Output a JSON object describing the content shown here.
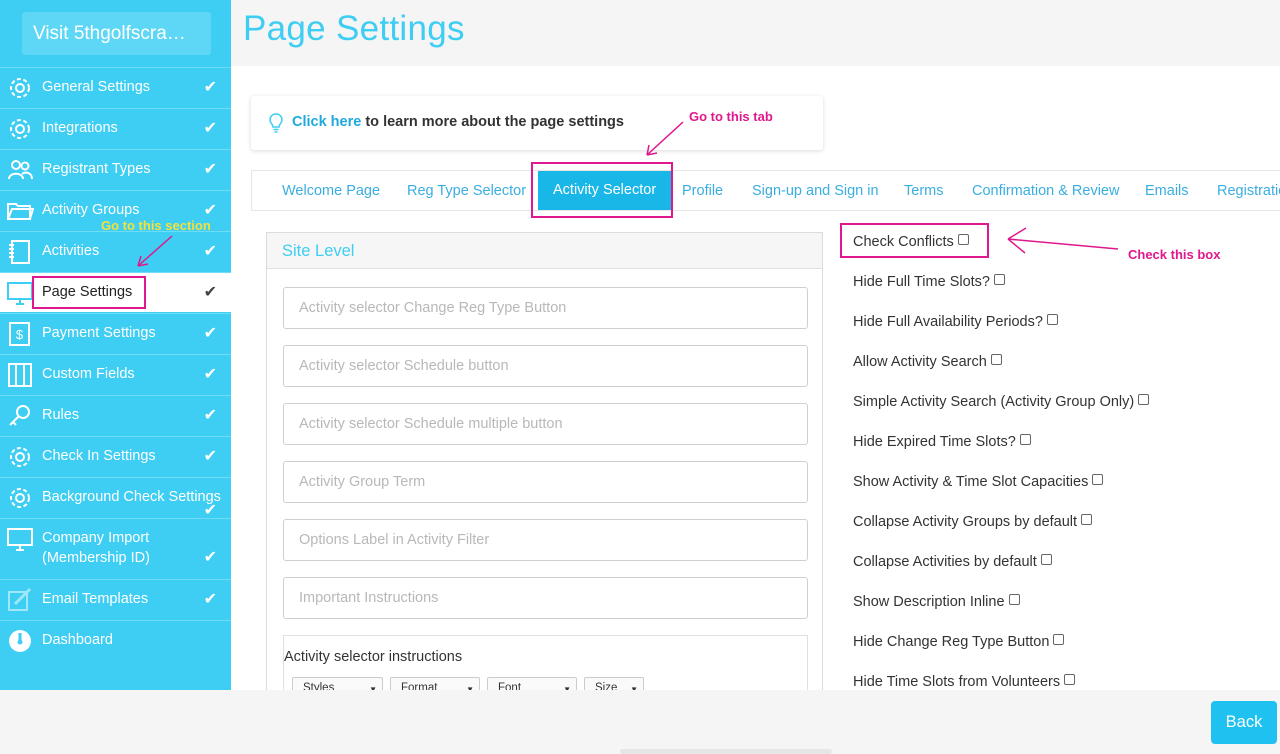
{
  "sidebar": {
    "visit_button": "Visit 5thgolfscra…",
    "items": [
      {
        "label": "General Settings",
        "icon": "gear-icon",
        "check": "✔"
      },
      {
        "label": "Integrations",
        "icon": "gear-icon",
        "check": "✔"
      },
      {
        "label": "Registrant Types",
        "icon": "users-icon",
        "check": "✔"
      },
      {
        "label": "Activity Groups",
        "icon": "folder-icon",
        "check": "✔"
      },
      {
        "label": "Activities",
        "icon": "notebook-icon",
        "check": "✔"
      },
      {
        "label": "Page Settings",
        "icon": "monitor-icon",
        "check": "✔"
      },
      {
        "label": "Payment Settings",
        "icon": "dollar-icon",
        "check": "✔"
      },
      {
        "label": "Custom Fields",
        "icon": "columns-icon",
        "check": "✔"
      },
      {
        "label": "Rules",
        "icon": "key-icon",
        "check": "✔"
      },
      {
        "label": "Check In Settings",
        "icon": "gear-icon",
        "check": "✔"
      },
      {
        "label": "Background Check Settings",
        "icon": "gear-icon",
        "check": "✔"
      },
      {
        "label": "Company Import",
        "label2": "(Membership ID)",
        "icon": "monitor-icon",
        "check": "✔"
      },
      {
        "label": "Email Templates",
        "icon": "edit-icon",
        "check": "✔"
      },
      {
        "label": "Dashboard",
        "icon": "gauge-icon",
        "check": ""
      }
    ]
  },
  "header": {
    "title": "Page Settings"
  },
  "info": {
    "link": "Click here",
    "text": " to learn more about the page settings"
  },
  "tabs": [
    "Welcome Page",
    "Reg Type Selector",
    "Activity Selector",
    "Profile",
    "Sign-up and Sign in",
    "Terms",
    "Confirmation & Review",
    "Emails",
    "Registration"
  ],
  "panel": {
    "title": "Site Level",
    "fields": [
      "Activity selector Change Reg Type Button",
      "Activity selector Schedule button",
      "Activity selector Schedule multiple button",
      "Activity Group Term",
      "Options Label in Activity Filter",
      "Important Instructions"
    ],
    "editor_label": "Activity selector instructions",
    "toolbar": [
      "Styles",
      "Format",
      "Font",
      "Size"
    ]
  },
  "options": [
    "Check Conflicts",
    "Hide Full Time Slots?",
    "Hide Full Availability Periods?",
    "Allow Activity Search",
    "Simple Activity Search (Activity Group Only)",
    "Hide Expired Time Slots?",
    "Show Activity & Time Slot Capacities",
    "Collapse Activity Groups by default",
    "Collapse Activities by default",
    "Show Description Inline",
    "Hide Change Reg Type Button",
    "Hide Time Slots from Volunteers"
  ],
  "annotations": {
    "tab": "Go to this tab",
    "section": "Go to this section",
    "box": "Check this box"
  },
  "footer": {
    "back": "Back"
  },
  "colors": {
    "accent": "#3ecdf3",
    "annotation": "#e0188d",
    "annotation_yellow": "#f2e23a"
  }
}
